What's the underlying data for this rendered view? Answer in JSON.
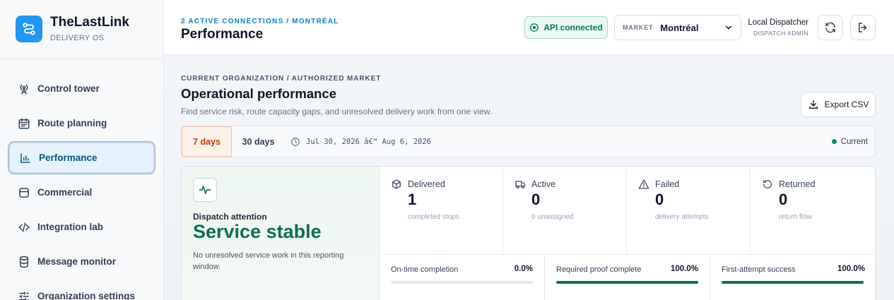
{
  "brand": {
    "name": "TheLastLink",
    "subtitle": "DELIVERY OS"
  },
  "sidebar": {
    "items": [
      {
        "label": "Control tower",
        "icon": "antenna-icon",
        "active": false
      },
      {
        "label": "Route planning",
        "icon": "calendar-icon",
        "active": false
      },
      {
        "label": "Performance",
        "icon": "bar-chart-icon",
        "active": true
      },
      {
        "label": "Commercial",
        "icon": "database-icon",
        "active": false
      },
      {
        "label": "Integration lab",
        "icon": "code-icon",
        "active": false
      },
      {
        "label": "Message monitor",
        "icon": "database-stack-icon",
        "active": false
      },
      {
        "label": "Organization settings",
        "icon": "sliders-icon",
        "active": false
      }
    ]
  },
  "header": {
    "breadcrumb": "2 ACTIVE CONNECTIONS / MONTRÉAL",
    "title": "Performance",
    "api_status": "API connected",
    "market_label": "MARKET",
    "market_value": "Montréal",
    "user_name": "Local Dispatcher",
    "user_role": "DISPATCH ADMIN"
  },
  "section": {
    "breadcrumb": "CURRENT ORGANIZATION / AUTHORIZED MARKET",
    "title": "Operational performance",
    "description": "Find service risk, route capacity gaps, and unresolved delivery work from one view.",
    "export_label": "Export CSV"
  },
  "range": {
    "option_7": "7 days",
    "option_30": "30 days",
    "dates": "Jul 30, 2026 â€“ Aug 6, 2026",
    "status": "Current"
  },
  "attention": {
    "label": "Dispatch attention",
    "title": "Service stable",
    "description": "No unresolved service work in this reporting window."
  },
  "kpis": [
    {
      "label": "Delivered",
      "value": "1",
      "sub": "completed stops",
      "icon": "package-icon"
    },
    {
      "label": "Active",
      "value": "0",
      "sub": "0 unassigned",
      "icon": "truck-icon"
    },
    {
      "label": "Failed",
      "value": "0",
      "sub": "delivery attempts",
      "icon": "warning-icon"
    },
    {
      "label": "Returned",
      "value": "0",
      "sub": "return flow",
      "icon": "return-icon"
    }
  ],
  "rates": [
    {
      "label": "On-time completion",
      "value": "0.0%",
      "percent": 0
    },
    {
      "label": "Required proof complete",
      "value": "100.0%",
      "percent": 100
    },
    {
      "label": "First-attempt success",
      "value": "100.0%",
      "percent": 100
    }
  ],
  "colors": {
    "accent": "#2196f3",
    "success": "#0f6e54",
    "warning": "#c2410c"
  }
}
